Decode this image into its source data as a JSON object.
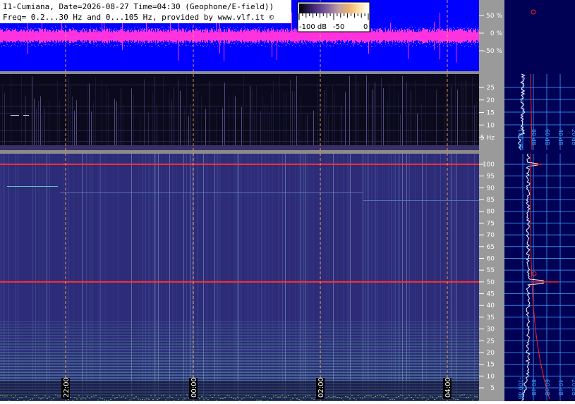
{
  "header": {
    "line1": "I1-Cumiana, Date=2026-08-27 Time=04:30 (Geophone/E-field))",
    "line2": "Freq= 0.2...30 Hz and 0...105 Hz, provided by www.vlf.it ©"
  },
  "colorbar": {
    "labels": [
      "-100 dB",
      "-50",
      "0"
    ],
    "stops": [
      "#000000",
      "#2a1a55",
      "#5a3a8a",
      "#8a6aa0",
      "#c0a0a0",
      "#e8b070",
      "#ffe0a0",
      "#ffffff"
    ]
  },
  "chart_data": [
    {
      "type": "line",
      "id": "waveform",
      "y_ticks": [
        "50 %",
        "0 %",
        "-50 %"
      ],
      "colors": {
        "background": "#0000ff",
        "signal": "#ff33dd"
      }
    },
    {
      "type": "heatmap",
      "id": "spectrogram-low",
      "y_ticks": [
        "25",
        "20",
        "15",
        "10",
        "5 Hz"
      ],
      "ylim": [
        0,
        30
      ],
      "colors": {
        "background": "#0a0a1c"
      }
    },
    {
      "type": "heatmap",
      "id": "spectrogram-high",
      "y_ticks": [
        "100",
        "95",
        "90",
        "85",
        "80",
        "75",
        "70",
        "65",
        "60",
        "55",
        "50",
        "45",
        "40",
        "35",
        "30",
        "25",
        "20",
        "15",
        "10",
        "5"
      ],
      "ylim": [
        0,
        105
      ],
      "time_labels": [
        "22:00",
        "00:00",
        "02:00",
        "04:00"
      ],
      "lines_hz": [
        100,
        50
      ],
      "colors": {
        "background": "#2c2c78",
        "hum": "#ff3030"
      }
    },
    {
      "type": "line",
      "id": "side-spectrum",
      "axis_labels": [
        "-100 dB",
        "-80 dB",
        "-60 dB",
        "-40 dB",
        "-20 dB"
      ],
      "colors": {
        "background": "#000055",
        "grid": "#3aa0ff",
        "trace": "#ffffff",
        "fit": "#ff2020"
      }
    }
  ]
}
